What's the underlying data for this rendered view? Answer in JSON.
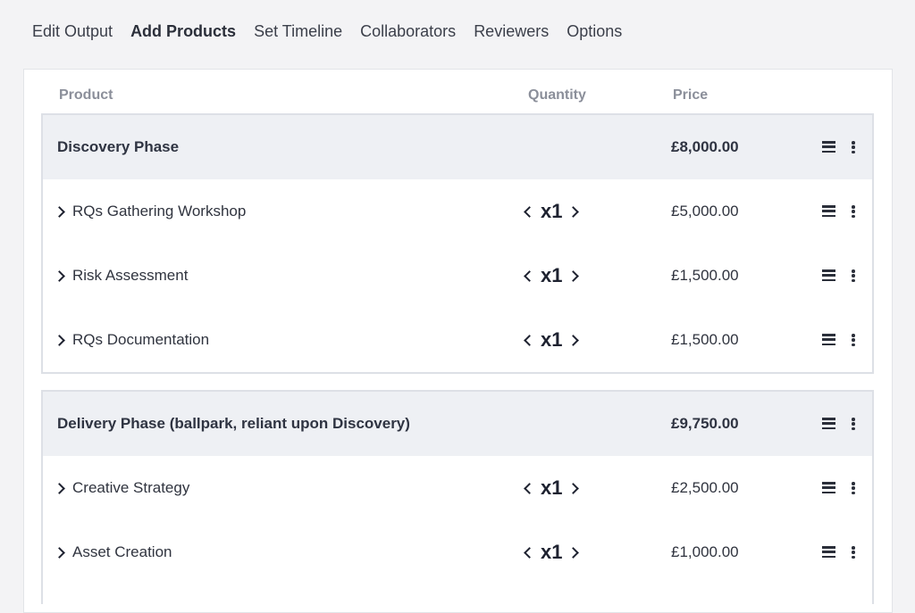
{
  "tabs": [
    {
      "label": "Edit Output"
    },
    {
      "label": "Add Products"
    },
    {
      "label": "Set Timeline"
    },
    {
      "label": "Collaborators"
    },
    {
      "label": "Reviewers"
    },
    {
      "label": "Options"
    }
  ],
  "active_tab": "Add Products",
  "columns": {
    "product": "Product",
    "quantity": "Quantity",
    "price": "Price"
  },
  "groups": [
    {
      "title": "Discovery Phase",
      "price": "£8,000.00",
      "items": [
        {
          "name": "RQs Gathering Workshop",
          "qty": "x1",
          "price": "£5,000.00"
        },
        {
          "name": "Risk Assessment",
          "qty": "x1",
          "price": "£1,500.00"
        },
        {
          "name": "RQs Documentation",
          "qty": "x1",
          "price": "£1,500.00"
        }
      ]
    },
    {
      "title": "Delivery Phase (ballpark, reliant upon Discovery)",
      "price": "£9,750.00",
      "items": [
        {
          "name": "Creative Strategy",
          "qty": "x1",
          "price": "£2,500.00"
        },
        {
          "name": "Asset Creation",
          "qty": "x1",
          "price": "£1,000.00"
        }
      ]
    }
  ],
  "icons": {
    "expand": "chevron-right-icon",
    "qty_decrease": "chevron-left-icon",
    "qty_increase": "chevron-right-icon",
    "drag": "drag-handle-icon",
    "more": "more-vertical-icon"
  },
  "colors": {
    "accent": "#ec7a4f",
    "group_header_bg": "#eef0f4",
    "page_bg": "#f3f3f5"
  }
}
